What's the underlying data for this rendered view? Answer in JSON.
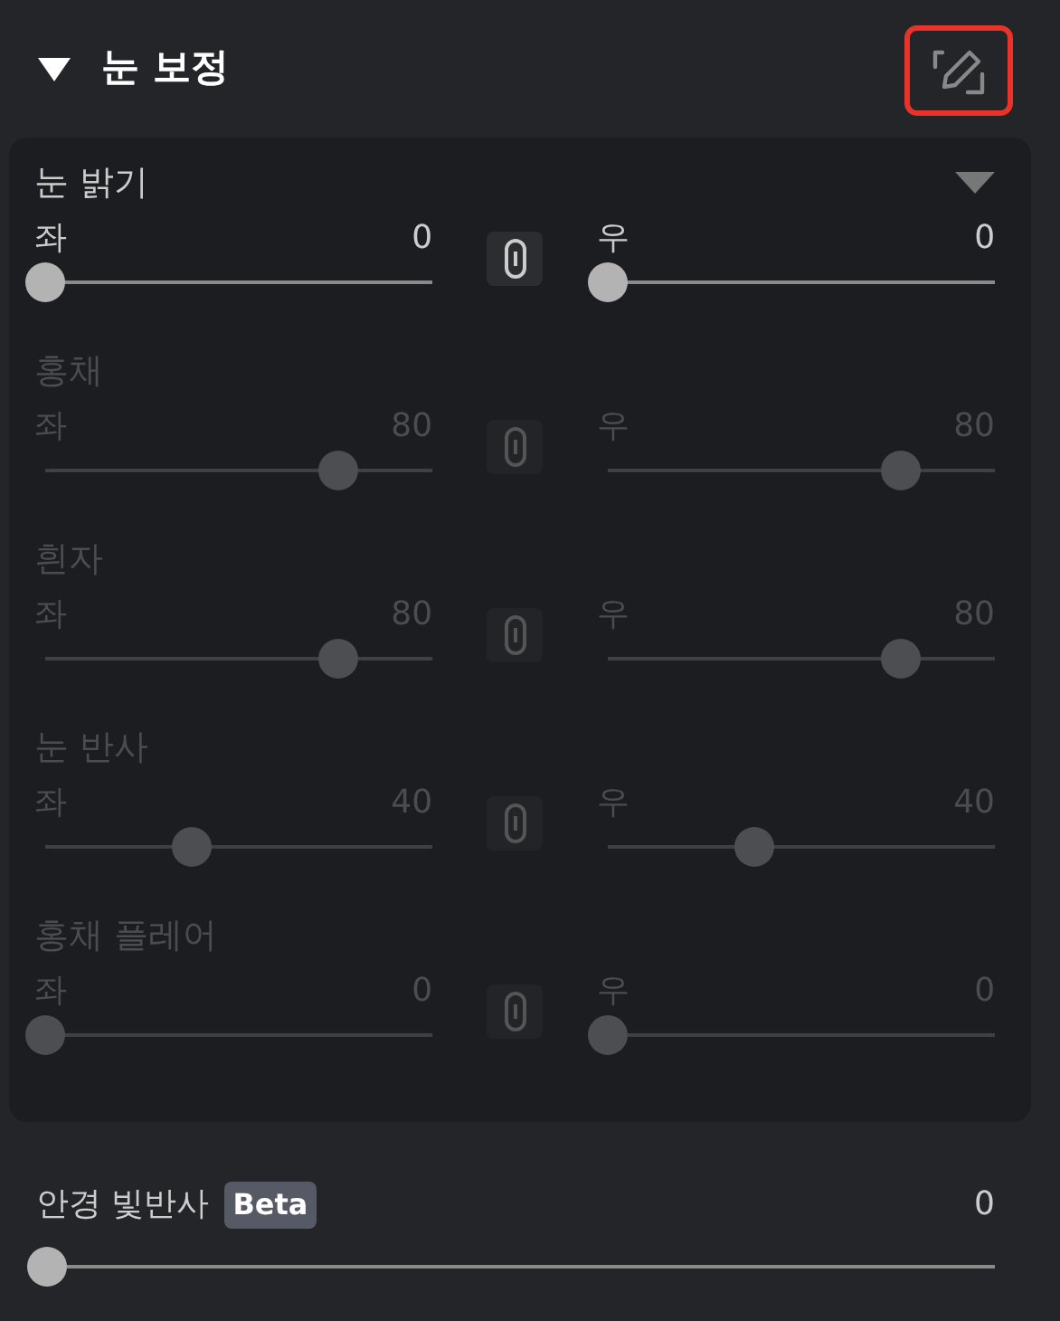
{
  "section": {
    "title": "눈 보정",
    "expanded": true,
    "edit_highlighted": true
  },
  "groups": [
    {
      "title": "눈 밝기",
      "disabled": false,
      "dropdown": true,
      "left": {
        "label": "좌",
        "value": "0",
        "level": 0
      },
      "right": {
        "label": "우",
        "value": "0",
        "level": 0
      }
    },
    {
      "title": "홍채",
      "disabled": true,
      "left": {
        "label": "좌",
        "value": "80",
        "level": 0.8
      },
      "right": {
        "label": "우",
        "value": "80",
        "level": 0.8
      }
    },
    {
      "title": "흰자",
      "disabled": true,
      "left": {
        "label": "좌",
        "value": "80",
        "level": 0.8
      },
      "right": {
        "label": "우",
        "value": "80",
        "level": 0.8
      }
    },
    {
      "title": "눈 반사",
      "disabled": true,
      "left": {
        "label": "좌",
        "value": "40",
        "level": 0.4
      },
      "right": {
        "label": "우",
        "value": "40",
        "level": 0.4
      }
    },
    {
      "title": "홍채 플레어",
      "disabled": true,
      "left": {
        "label": "좌",
        "value": "0",
        "level": 0
      },
      "right": {
        "label": "우",
        "value": "0",
        "level": 0
      }
    }
  ],
  "glasses": {
    "label": "안경 빛반사",
    "badge": "Beta",
    "value": "0",
    "level": 0
  }
}
